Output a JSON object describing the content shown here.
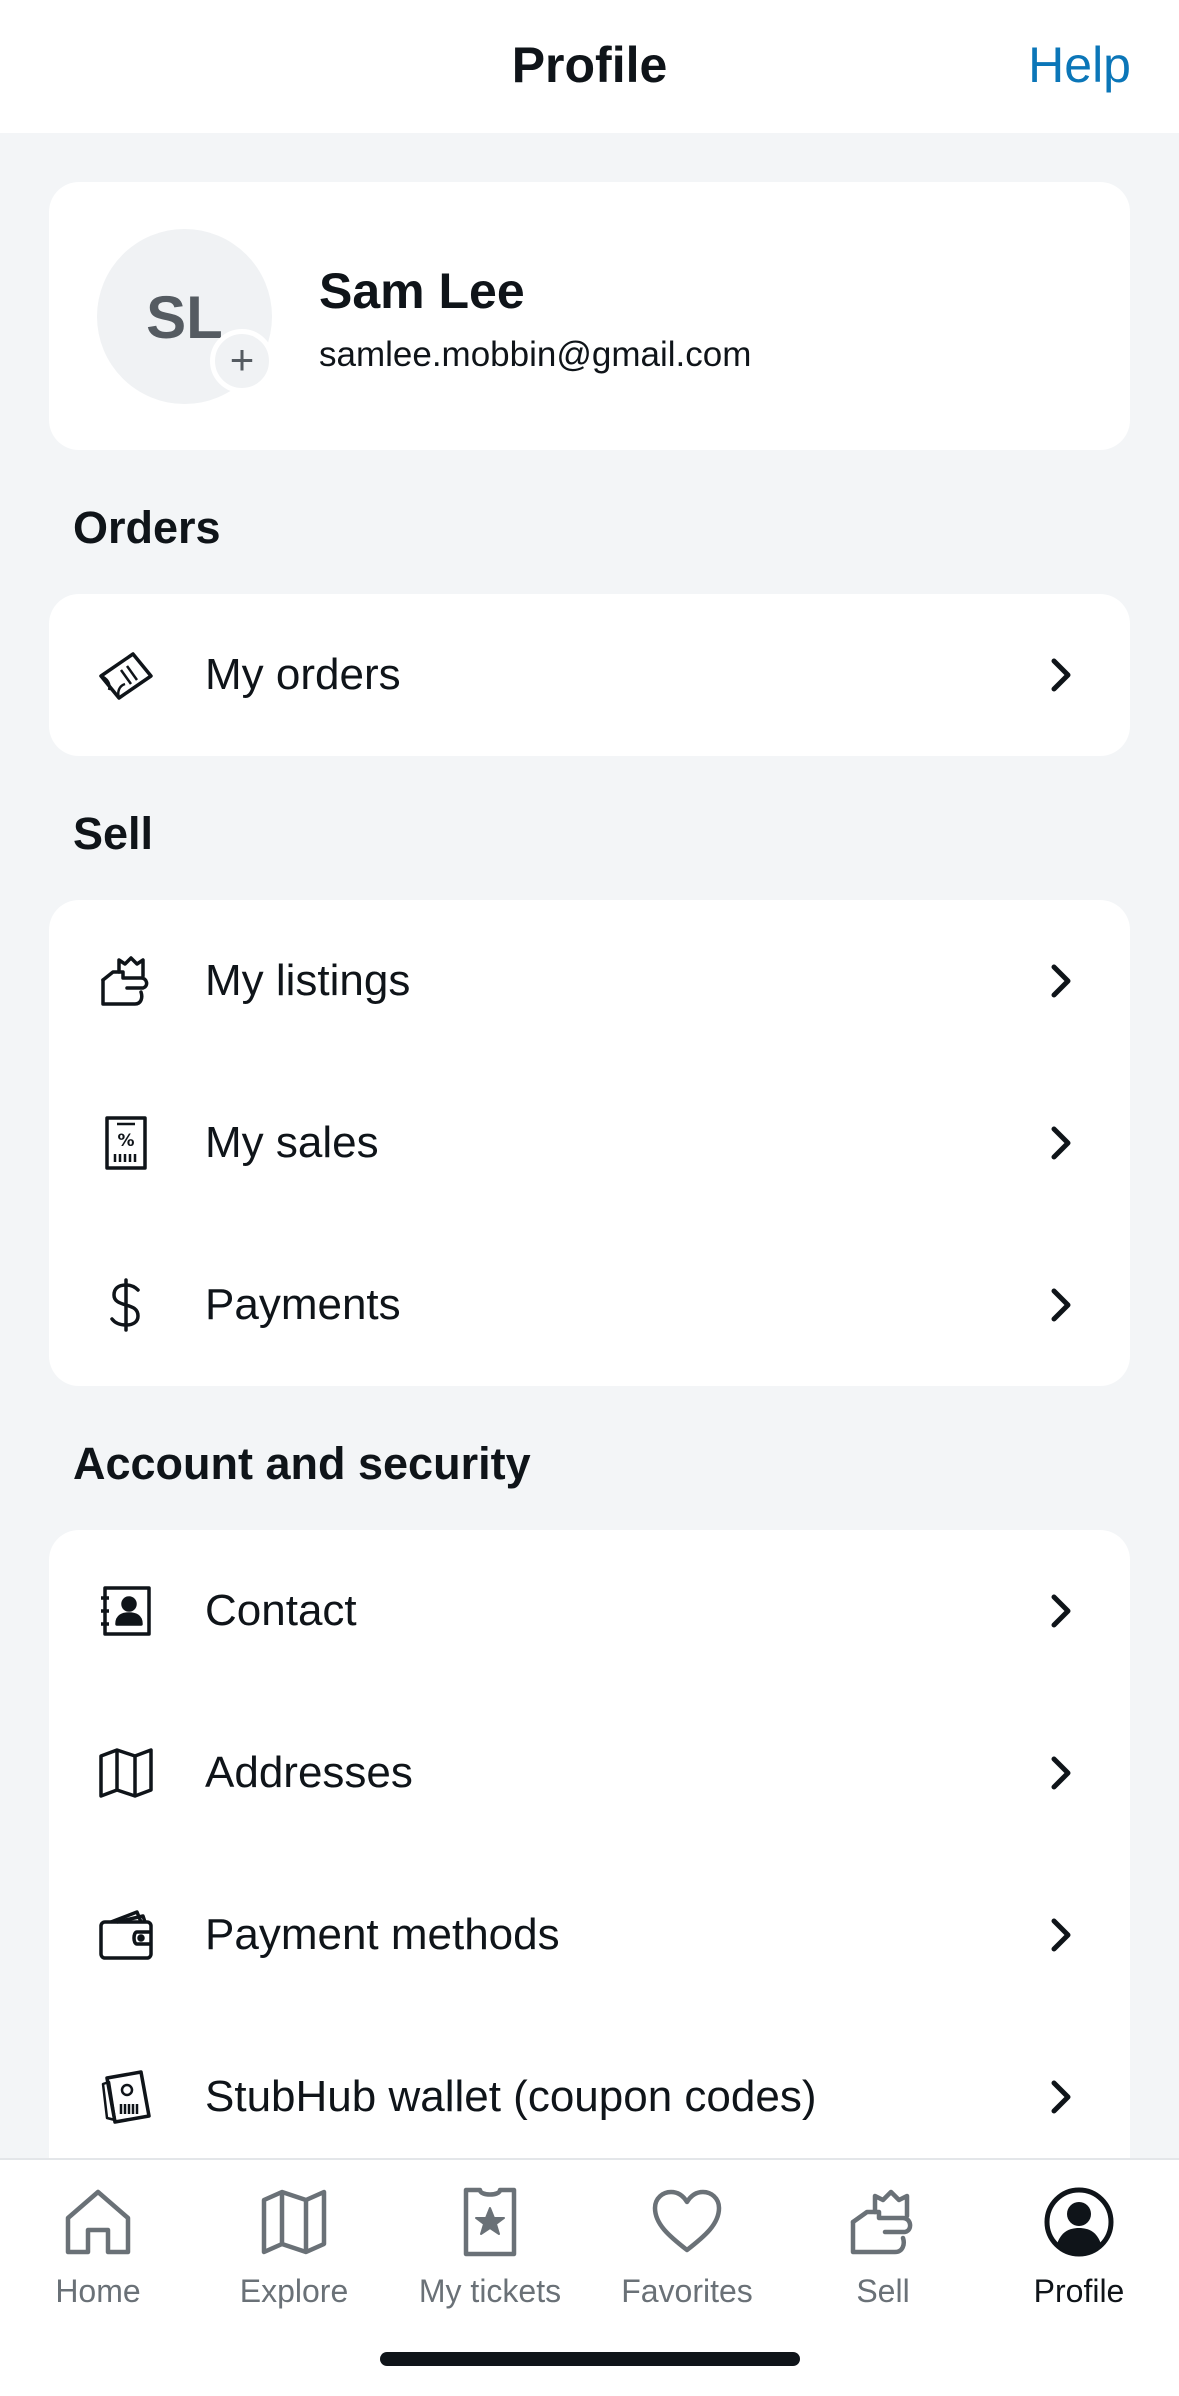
{
  "header": {
    "title": "Profile",
    "help_label": "Help"
  },
  "profile": {
    "initials": "SL",
    "name": "Sam Lee",
    "email": "samlee.mobbin@gmail.com",
    "add_glyph": "+"
  },
  "sections": {
    "orders": {
      "title": "Orders",
      "items": [
        {
          "label": "My orders",
          "icon": "ticket-icon"
        }
      ]
    },
    "sell": {
      "title": "Sell",
      "items": [
        {
          "label": "My listings",
          "icon": "hand-ticket-icon"
        },
        {
          "label": "My sales",
          "icon": "receipt-percent-icon"
        },
        {
          "label": "Payments",
          "icon": "dollar-icon"
        }
      ]
    },
    "account": {
      "title": "Account and security",
      "items": [
        {
          "label": "Contact",
          "icon": "contact-card-icon"
        },
        {
          "label": "Addresses",
          "icon": "map-icon"
        },
        {
          "label": "Payment methods",
          "icon": "wallet-icon"
        },
        {
          "label": "StubHub wallet (coupon codes)",
          "icon": "coupon-icon"
        }
      ]
    }
  },
  "tabbar": {
    "items": [
      {
        "label": "Home",
        "icon": "home-icon",
        "active": false
      },
      {
        "label": "Explore",
        "icon": "map-icon",
        "active": false
      },
      {
        "label": "My tickets",
        "icon": "ticket-star-icon",
        "active": false
      },
      {
        "label": "Favorites",
        "icon": "heart-icon",
        "active": false
      },
      {
        "label": "Sell",
        "icon": "hand-ticket-icon",
        "active": false
      },
      {
        "label": "Profile",
        "icon": "profile-icon",
        "active": true
      }
    ]
  },
  "colors": {
    "accent": "#0b76b8",
    "background": "#f3f5f7",
    "text": "#0f1419",
    "inactive": "#6a7177"
  }
}
